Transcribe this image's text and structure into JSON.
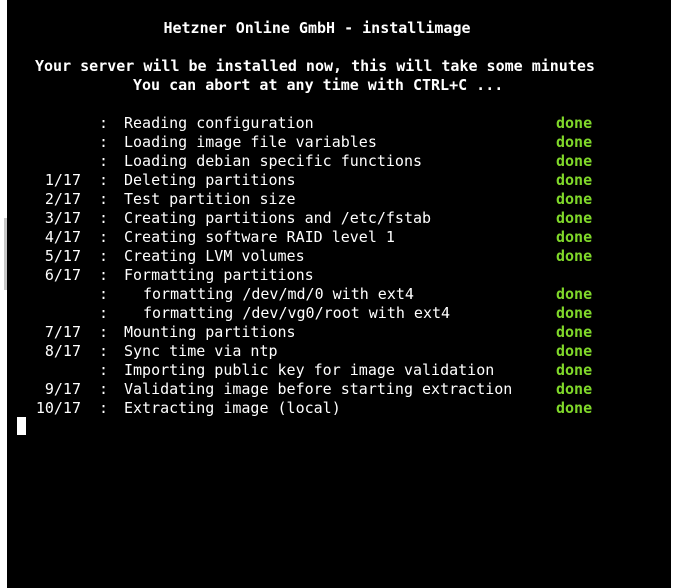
{
  "terminal": {
    "title": "Hetzner Online GmbH - installimage",
    "notice_line1": "Your server will be installed now, this will take some minutes",
    "notice_line2": "You can abort at any time with CTRL+C ...",
    "separator": ":",
    "status_color": "#80d82a",
    "rows": [
      {
        "step": "",
        "label": "Reading configuration",
        "status": "done",
        "indent": false
      },
      {
        "step": "",
        "label": "Loading image file variables",
        "status": "done",
        "indent": false
      },
      {
        "step": "",
        "label": "Loading debian specific functions",
        "status": "done",
        "indent": false
      },
      {
        "step": "1/17",
        "label": "Deleting partitions",
        "status": "done",
        "indent": false
      },
      {
        "step": "2/17",
        "label": "Test partition size",
        "status": "done",
        "indent": false
      },
      {
        "step": "3/17",
        "label": "Creating partitions and /etc/fstab",
        "status": "done",
        "indent": false
      },
      {
        "step": "4/17",
        "label": "Creating software RAID level 1",
        "status": "done",
        "indent": false
      },
      {
        "step": "5/17",
        "label": "Creating LVM volumes",
        "status": "done",
        "indent": false
      },
      {
        "step": "6/17",
        "label": "Formatting partitions",
        "status": "",
        "indent": false
      },
      {
        "step": "",
        "label": "formatting /dev/md/0 with ext4",
        "status": "done",
        "indent": true
      },
      {
        "step": "",
        "label": "formatting /dev/vg0/root with ext4",
        "status": "done",
        "indent": true
      },
      {
        "step": "7/17",
        "label": "Mounting partitions",
        "status": "done",
        "indent": false
      },
      {
        "step": "8/17",
        "label": "Sync time via ntp",
        "status": "done",
        "indent": false
      },
      {
        "step": "",
        "label": "Importing public key for image validation",
        "status": "done",
        "indent": false
      },
      {
        "step": "9/17",
        "label": "Validating image before starting extraction",
        "status": "done",
        "indent": false
      },
      {
        "step": "10/17",
        "label": "Extracting image (local)",
        "status": "done",
        "indent": false
      }
    ]
  }
}
